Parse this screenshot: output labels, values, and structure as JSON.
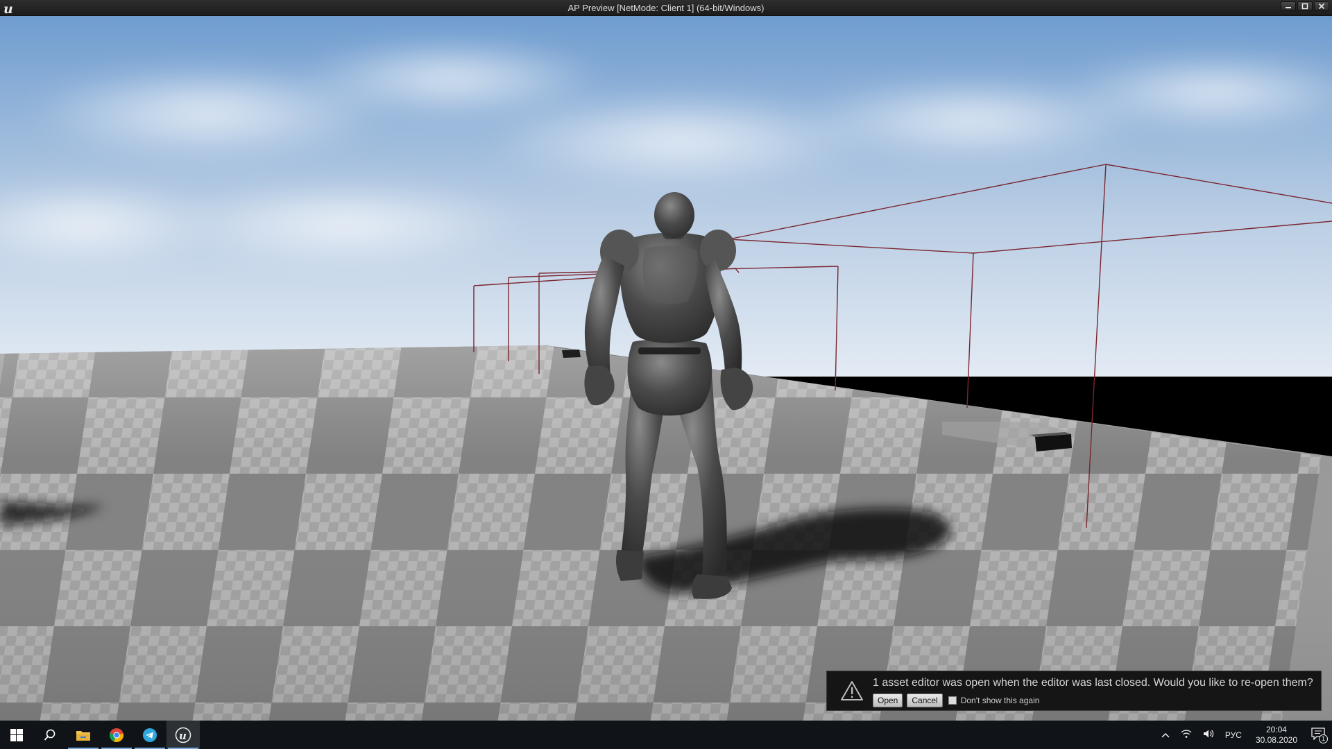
{
  "window": {
    "title": "AP Preview [NetMode: Client 1] (64-bit/Windows)",
    "app_icon": "unreal-engine-icon",
    "controls": {
      "minimize": "minimize-icon",
      "maximize": "maximize-icon",
      "close": "close-icon"
    }
  },
  "notification": {
    "message": "1 asset editor was open when the editor was last closed. Would you like to re-open them?",
    "open_label": "Open",
    "cancel_label": "Cancel",
    "checkbox_label": "Don't show this again",
    "checkbox_checked": false,
    "icon": "warning-icon"
  },
  "taskbar": {
    "items": [
      {
        "name": "start",
        "icon": "windows-start-icon"
      },
      {
        "name": "search",
        "icon": "search-icon"
      },
      {
        "name": "file-explorer",
        "icon": "folder-icon"
      },
      {
        "name": "chrome",
        "icon": "chrome-icon"
      },
      {
        "name": "telegram",
        "icon": "telegram-icon"
      },
      {
        "name": "unreal-engine",
        "icon": "unreal-engine-icon",
        "active": true
      }
    ],
    "tray": {
      "language": "РУС",
      "time": "20:04",
      "date": "30.08.2020",
      "notification_count": "1"
    }
  },
  "colors": {
    "sky_top": "#6f9ccf",
    "sky_bottom": "#dfe8f2",
    "floor_light": "#a9a9a9",
    "floor_dark": "#7d7d7d",
    "bounds_line": "#7a2630",
    "taskbar_bg": "#101418"
  }
}
